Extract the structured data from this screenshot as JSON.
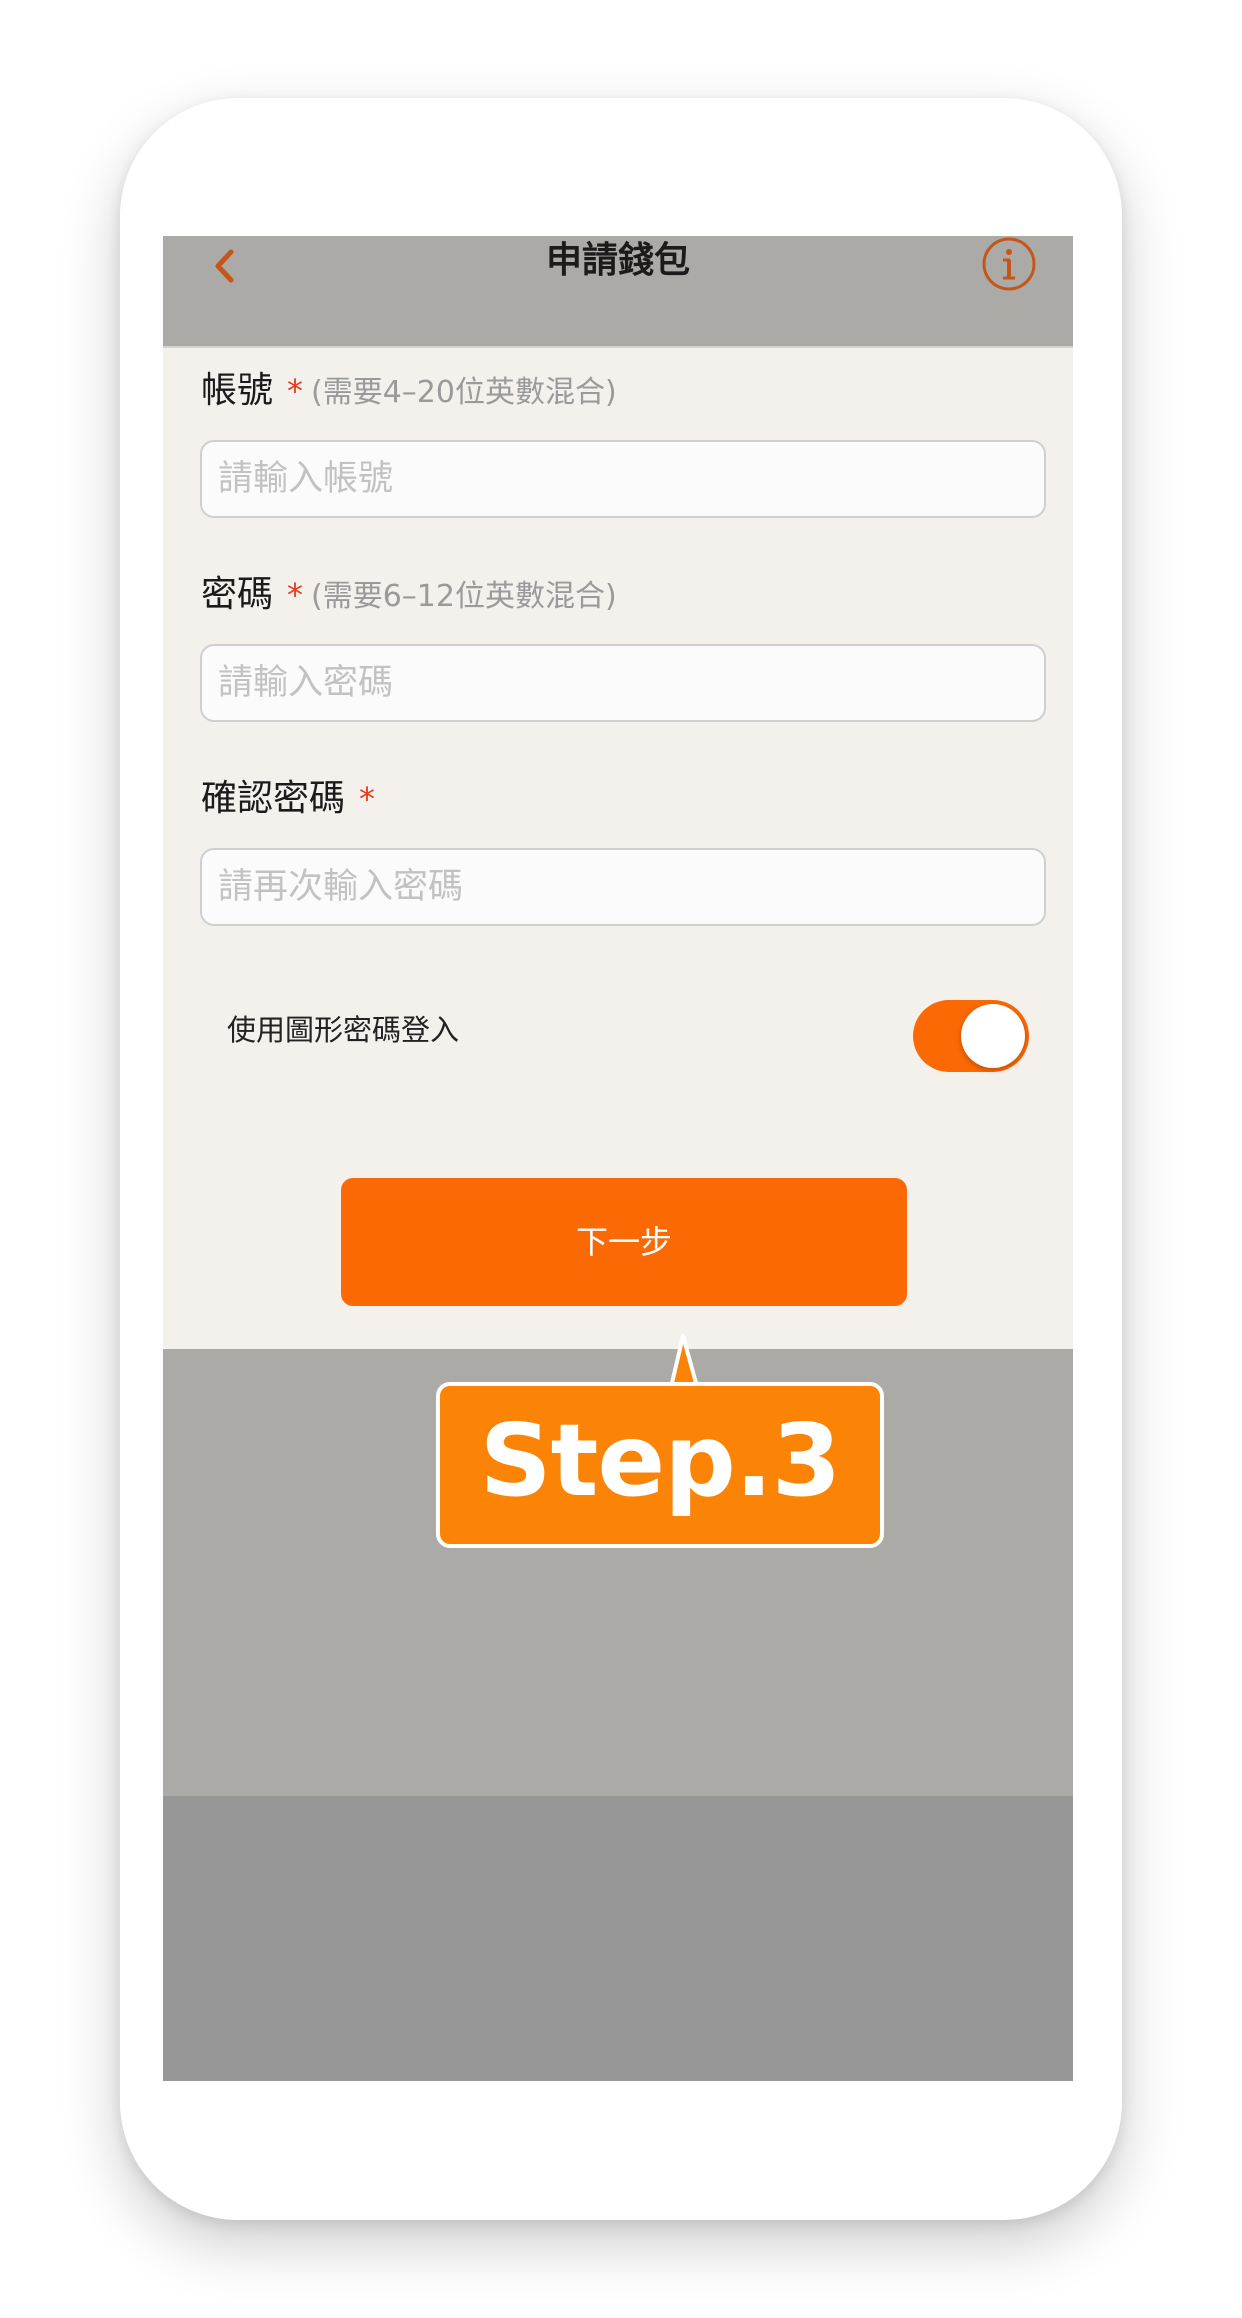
{
  "navbar": {
    "title": "申請錢包",
    "back_icon": "chevron-left-icon",
    "info_icon": "info-circle-icon"
  },
  "form": {
    "account": {
      "label": "帳號",
      "required_mark": "*",
      "hint": "(需要4–20位英數混合)",
      "placeholder": "請輸入帳號",
      "value": ""
    },
    "password": {
      "label": "密碼",
      "required_mark": "*",
      "hint": "(需要6–12位英數混合)",
      "placeholder": "請輸入密碼",
      "value": ""
    },
    "confirm_password": {
      "label": "確認密碼",
      "required_mark": "*",
      "placeholder": "請再次輸入密碼",
      "value": ""
    },
    "pattern_login": {
      "label": "使用圖形密碼登入",
      "enabled": true
    },
    "next_button_label": "下一步"
  },
  "callout": {
    "text": "Step.3"
  },
  "colors": {
    "accent": "#fb6905",
    "callout": "#fb8407",
    "nav_icon": "#c4561a",
    "required": "#e53a1f",
    "form_bg": "#f4f1ed",
    "overlay_bg": "#acaaa6"
  }
}
